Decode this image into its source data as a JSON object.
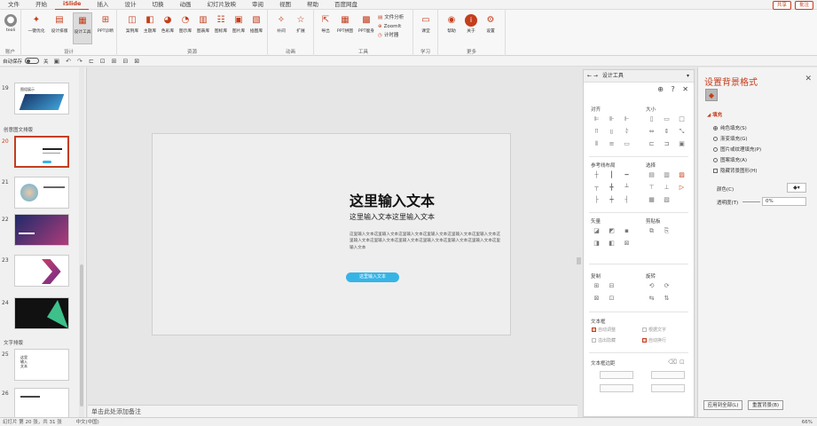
{
  "menu": {
    "tabs": [
      "文件",
      "开始",
      "iSlide",
      "插入",
      "设计",
      "切换",
      "动画",
      "幻灯片放映",
      "审阅",
      "视图",
      "帮助",
      "百度网盘"
    ],
    "active_index": 2,
    "share": "共享",
    "comment": "批注"
  },
  "ribbon": {
    "account": {
      "name": "teoli",
      "group": "账户"
    },
    "design_group": {
      "label": "设计",
      "buttons": [
        "一键优化",
        "设计排版",
        "设计工具",
        "PPT诊断"
      ]
    },
    "resource_group": {
      "label": "资源",
      "buttons": [
        "案例库",
        "主题库",
        "色彩库",
        "图示库",
        "图表库",
        "图标库",
        "图片库",
        "插图库"
      ]
    },
    "animation_group": {
      "label": "动画",
      "buttons": [
        "补间",
        "扩展"
      ]
    },
    "tools_group": {
      "label": "工具",
      "buttons": [
        "导出",
        "PPT拼图",
        "PPT瘦身"
      ],
      "small": [
        "文件分析",
        "ZoomIt",
        "计时器"
      ]
    },
    "learn_group": {
      "label": "学习",
      "buttons": [
        "课堂"
      ]
    },
    "more_group": {
      "label": "更多",
      "buttons": [
        "帮助",
        "关于",
        "设置"
      ]
    }
  },
  "qat": {
    "autosave_label": "自动保存",
    "autosave_state": "关"
  },
  "slides": {
    "items": [
      {
        "num": "19"
      },
      {
        "num": "20"
      },
      {
        "num": "21"
      },
      {
        "num": "22"
      },
      {
        "num": "23"
      },
      {
        "num": "24"
      },
      {
        "num": "25"
      },
      {
        "num": "26"
      }
    ],
    "selected": "20",
    "sections": [
      "创意图文排版",
      "文字排版"
    ],
    "thumb_text": {
      "s19": "图组展示",
      "s25": "这里\n输入\n文本"
    }
  },
  "slide": {
    "title": "这里输入文本",
    "subtitle": "这里输入文本这里输入文本",
    "body": "这里输入文本这里输入文本这里输入文本这里输入文本这里输入文本这里输入文本这里输入文本这里输入文本这里输入文本这里输入文本这里输入文本这里输入文本这里输入文本",
    "button": "这里输入文本"
  },
  "notes_placeholder": "单击此处添加备注",
  "design_tools": {
    "title": "设计工具",
    "sections": {
      "align": "对齐",
      "size": "大小",
      "guides": "参考线布局",
      "select": "选择",
      "vector": "矢量",
      "clip": "剪贴板",
      "copy": "复制",
      "rotate": "旋转",
      "textbox": "文本框",
      "textbox_margin": "文本框边距"
    },
    "textbox_options": [
      "自动调整",
      "根据文字",
      "溢出隐藏",
      "自动换行"
    ]
  },
  "format_bg": {
    "title": "设置背景格式",
    "fill_label": "填充",
    "options": [
      "纯色填充(S)",
      "渐变填充(G)",
      "图片或纹理填充(P)",
      "图案填充(A)",
      "隐藏背景图形(H)"
    ],
    "selected_option": 0,
    "color_label": "颜色(C)",
    "transparency_label": "透明度(T)",
    "transparency_value": "0%",
    "apply_all": "应用到全部(L)",
    "reset": "重置背景(B)"
  },
  "status": {
    "left": "幻灯片 第 20 张，共 31 张",
    "lang": "中文(中国)",
    "zoom": "66%"
  }
}
